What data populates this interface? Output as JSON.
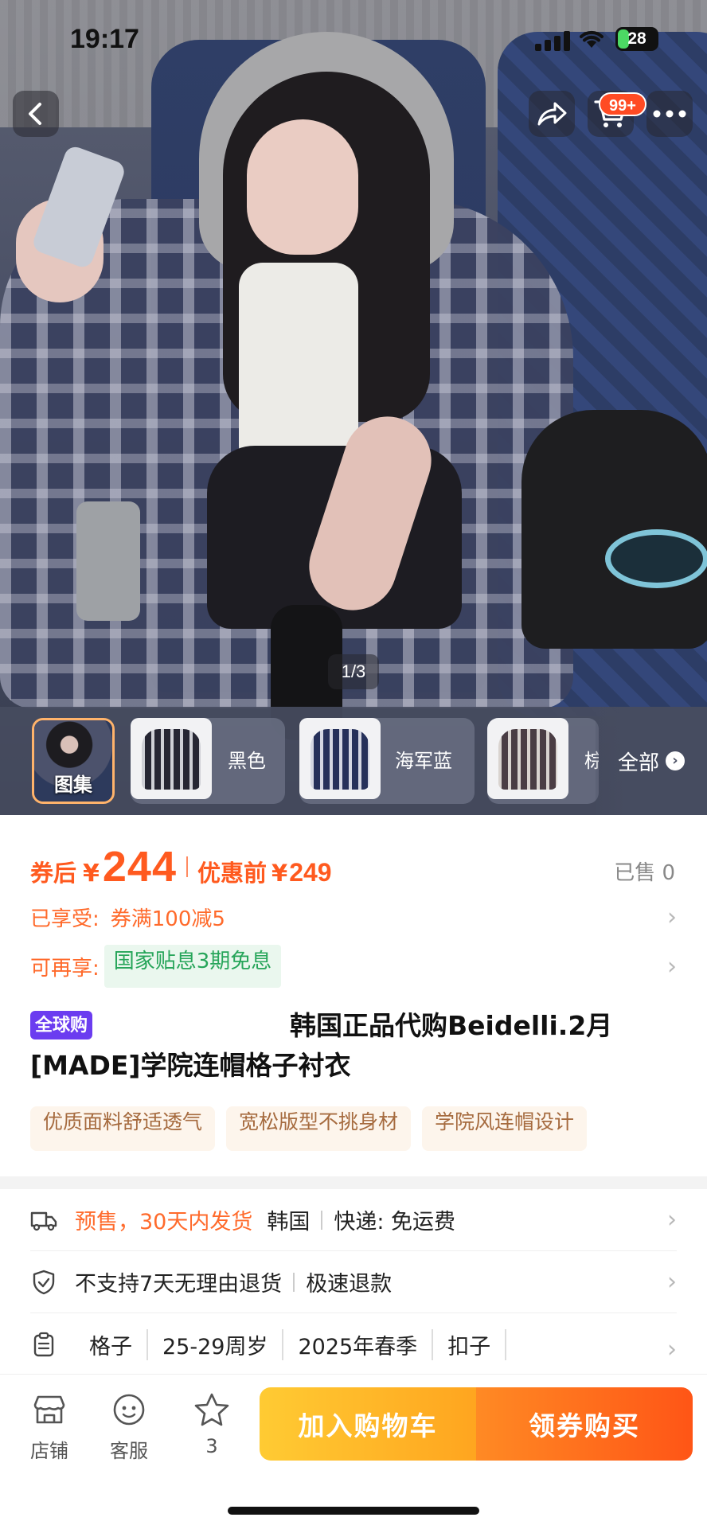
{
  "status_bar": {
    "time": "19:17",
    "battery": "28"
  },
  "top_nav": {
    "cart_badge": "99+"
  },
  "gallery": {
    "page_indicator": "1/3"
  },
  "thumbnails": {
    "gallery_label": "图集",
    "variants": [
      "黑色",
      "海军蓝",
      "棕"
    ],
    "all_label": "全部"
  },
  "price": {
    "after_coupon_label": "券后",
    "currency": "¥",
    "after_coupon_value": "244",
    "before_label": "优惠前",
    "before_value": "249",
    "sold": "已售 0"
  },
  "promos": {
    "enjoyed_label": "已享受:",
    "enjoyed_value": "券满100减5",
    "more_label": "可再享:",
    "more_value": "国家贴息3期免息"
  },
  "product": {
    "global_tag": "全球购",
    "title": "韩国正品代购Beidelli.2月[MADE]学院连帽格子衬衣",
    "feature_tags": [
      "优质面料舒适透气",
      "宽松版型不挑身材",
      "学院风连帽设计"
    ]
  },
  "specs": {
    "shipping_orange": "预售，30天内发货",
    "origin": "韩国",
    "delivery": "快递: 免运费",
    "returns": "不支持7天无理由退货",
    "refund": "极速退款",
    "attrs": [
      "格子",
      "25-29周岁",
      "2025年春季",
      "扣子"
    ]
  },
  "bottom_bar": {
    "store": "店铺",
    "service": "客服",
    "favorites": "3",
    "add_to_cart": "加入购物车",
    "buy": "领券购买"
  },
  "colors": {
    "price_orange": "#ff5a1f",
    "subsidy_green": "#27a55a",
    "global_purple": "#6b3cf0",
    "cart_yellow": "#ffb32a",
    "buy_orange": "#ff6a1f"
  }
}
